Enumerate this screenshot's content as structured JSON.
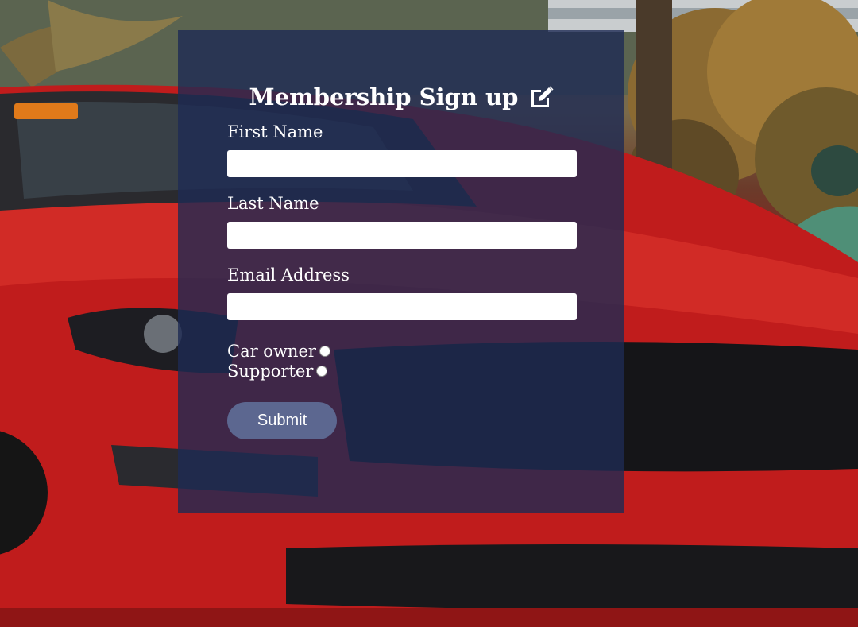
{
  "form": {
    "title": "Membership Sign up",
    "title_icon": "edit-icon",
    "fields": [
      {
        "label": "First Name",
        "value": "",
        "placeholder": ""
      },
      {
        "label": "Last Name",
        "value": "",
        "placeholder": ""
      },
      {
        "label": "Email Address",
        "value": "",
        "placeholder": ""
      }
    ],
    "radios": [
      {
        "label": "Car owner",
        "checked": false
      },
      {
        "label": "Supporter",
        "checked": false
      }
    ],
    "submit_label": "Submit"
  },
  "colors": {
    "panel_overlay": "#1e2a54",
    "button": "#5c6790",
    "text": "#ffffff",
    "car_red": "#c41e1e"
  }
}
